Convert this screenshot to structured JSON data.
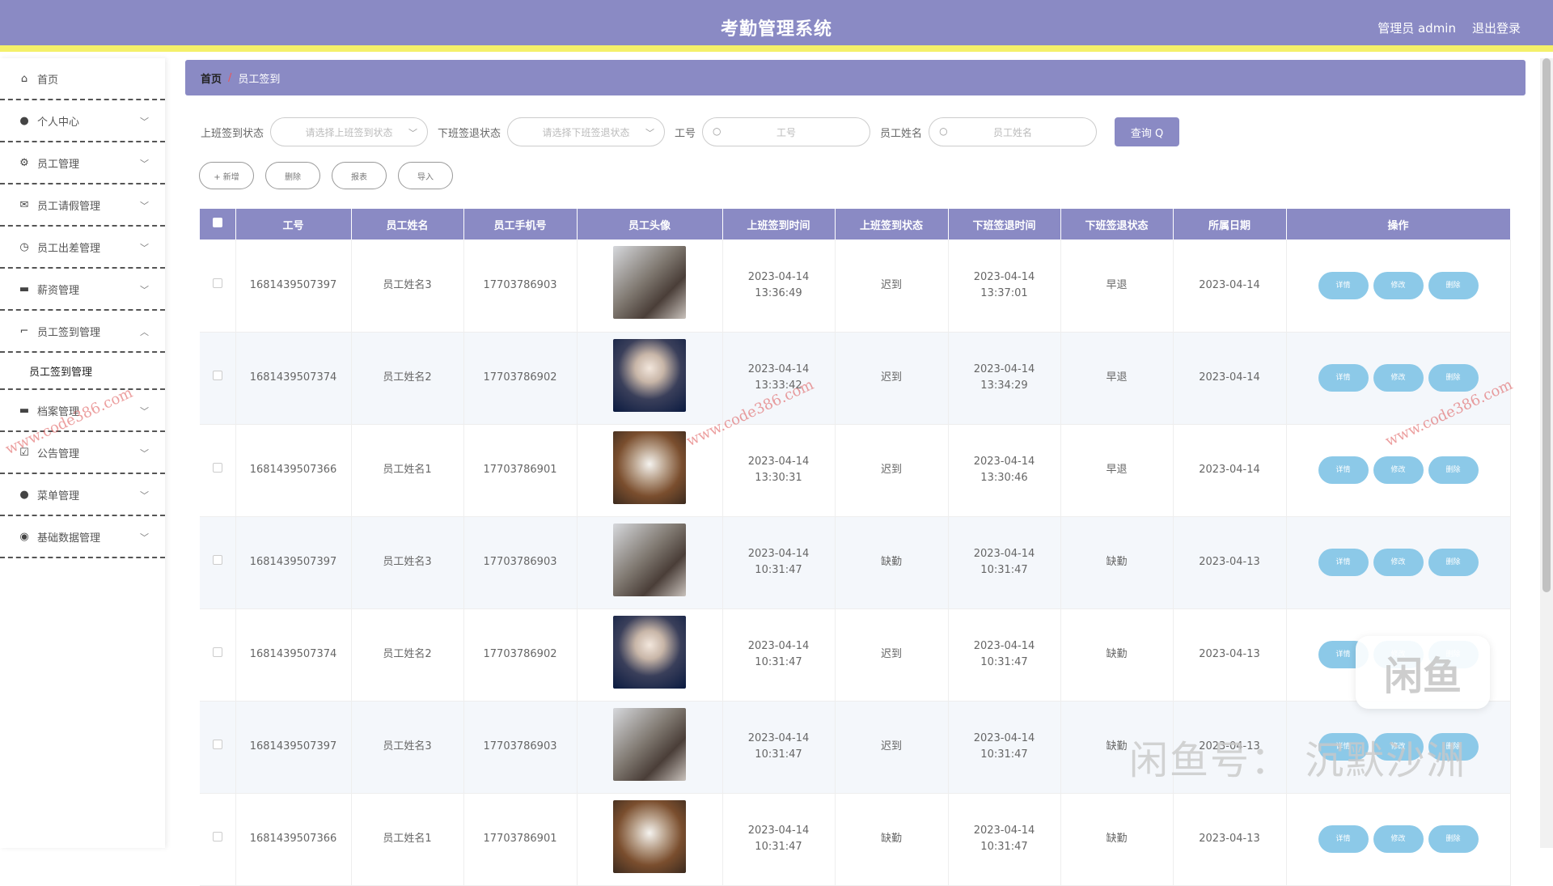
{
  "header": {
    "title": "考勤管理系统",
    "user": "管理员 admin",
    "logout": "退出登录"
  },
  "sidebar": {
    "items": [
      {
        "label": "首页",
        "icon": "home-icon"
      },
      {
        "label": "个人中心",
        "icon": "user-icon"
      },
      {
        "label": "员工管理",
        "icon": "gear-icon"
      },
      {
        "label": "员工请假管理",
        "icon": "mail-icon"
      },
      {
        "label": "员工出差管理",
        "icon": "clock-icon"
      },
      {
        "label": "薪资管理",
        "icon": "chat-icon"
      },
      {
        "label": "员工签到管理",
        "icon": "crop-icon"
      },
      {
        "label": "档案管理",
        "icon": "chat-icon"
      },
      {
        "label": "公告管理",
        "icon": "check-icon"
      },
      {
        "label": "菜单管理",
        "icon": "user-icon"
      },
      {
        "label": "基础数据管理",
        "icon": "pin-icon"
      }
    ],
    "sub_item": "员工签到管理"
  },
  "breadcrumb": {
    "home": "首页",
    "separator": "/",
    "current": "员工签到"
  },
  "search": {
    "label_in": "上班签到状态",
    "placeholder_in": "请选择上班签到状态",
    "label_out": "下班签退状态",
    "placeholder_out": "请选择下班签退状态",
    "label_no": "工号",
    "placeholder_no": "工号",
    "label_name": "员工姓名",
    "placeholder_name": "员工姓名",
    "query": "查询 Q"
  },
  "actions": {
    "add": "+ 新增",
    "delete": "删除",
    "report": "报表",
    "import": "导入"
  },
  "table": {
    "headers": [
      "工号",
      "员工姓名",
      "员工手机号",
      "员工头像",
      "上班签到时间",
      "上班签到状态",
      "下班签退时间",
      "下班签退状态",
      "所属日期",
      "操作"
    ],
    "op_labels": {
      "detail": "详情",
      "edit": "修改",
      "delete": "删除"
    },
    "rows": [
      {
        "no": "1681439507397",
        "name": "员工姓名3",
        "phone": "17703786903",
        "avatar": "girl",
        "in_time": "2023-04-14 13:36:49",
        "in_status": "迟到",
        "out_time": "2023-04-14 13:37:01",
        "out_status": "早退",
        "date": "2023-04-14"
      },
      {
        "no": "1681439507374",
        "name": "员工姓名2",
        "phone": "17703786902",
        "avatar": "boy",
        "in_time": "2023-04-14 13:33:42",
        "in_status": "迟到",
        "out_time": "2023-04-14 13:34:29",
        "out_status": "早退",
        "date": "2023-04-14"
      },
      {
        "no": "1681439507366",
        "name": "员工姓名1",
        "phone": "17703786901",
        "avatar": "cat",
        "in_time": "2023-04-14 13:30:31",
        "in_status": "迟到",
        "out_time": "2023-04-14 13:30:46",
        "out_status": "早退",
        "date": "2023-04-14"
      },
      {
        "no": "1681439507397",
        "name": "员工姓名3",
        "phone": "17703786903",
        "avatar": "girl",
        "in_time": "2023-04-14 10:31:47",
        "in_status": "缺勤",
        "out_time": "2023-04-14 10:31:47",
        "out_status": "缺勤",
        "date": "2023-04-13"
      },
      {
        "no": "1681439507374",
        "name": "员工姓名2",
        "phone": "17703786902",
        "avatar": "boy",
        "in_time": "2023-04-14 10:31:47",
        "in_status": "迟到",
        "out_time": "2023-04-14 10:31:47",
        "out_status": "缺勤",
        "date": "2023-04-13"
      },
      {
        "no": "1681439507397",
        "name": "员工姓名3",
        "phone": "17703786903",
        "avatar": "girl",
        "in_time": "2023-04-14 10:31:47",
        "in_status": "迟到",
        "out_time": "2023-04-14 10:31:47",
        "out_status": "缺勤",
        "date": "2023-04-13"
      },
      {
        "no": "1681439507366",
        "name": "员工姓名1",
        "phone": "17703786901",
        "avatar": "cat",
        "in_time": "2023-04-14 10:31:47",
        "in_status": "缺勤",
        "out_time": "2023-04-14 10:31:47",
        "out_status": "缺勤",
        "date": "2023-04-13"
      }
    ]
  },
  "watermarks": {
    "site": "www.code386.com",
    "xianyu": "闲鱼号： 沉默沙洲",
    "logo": "闲鱼"
  }
}
